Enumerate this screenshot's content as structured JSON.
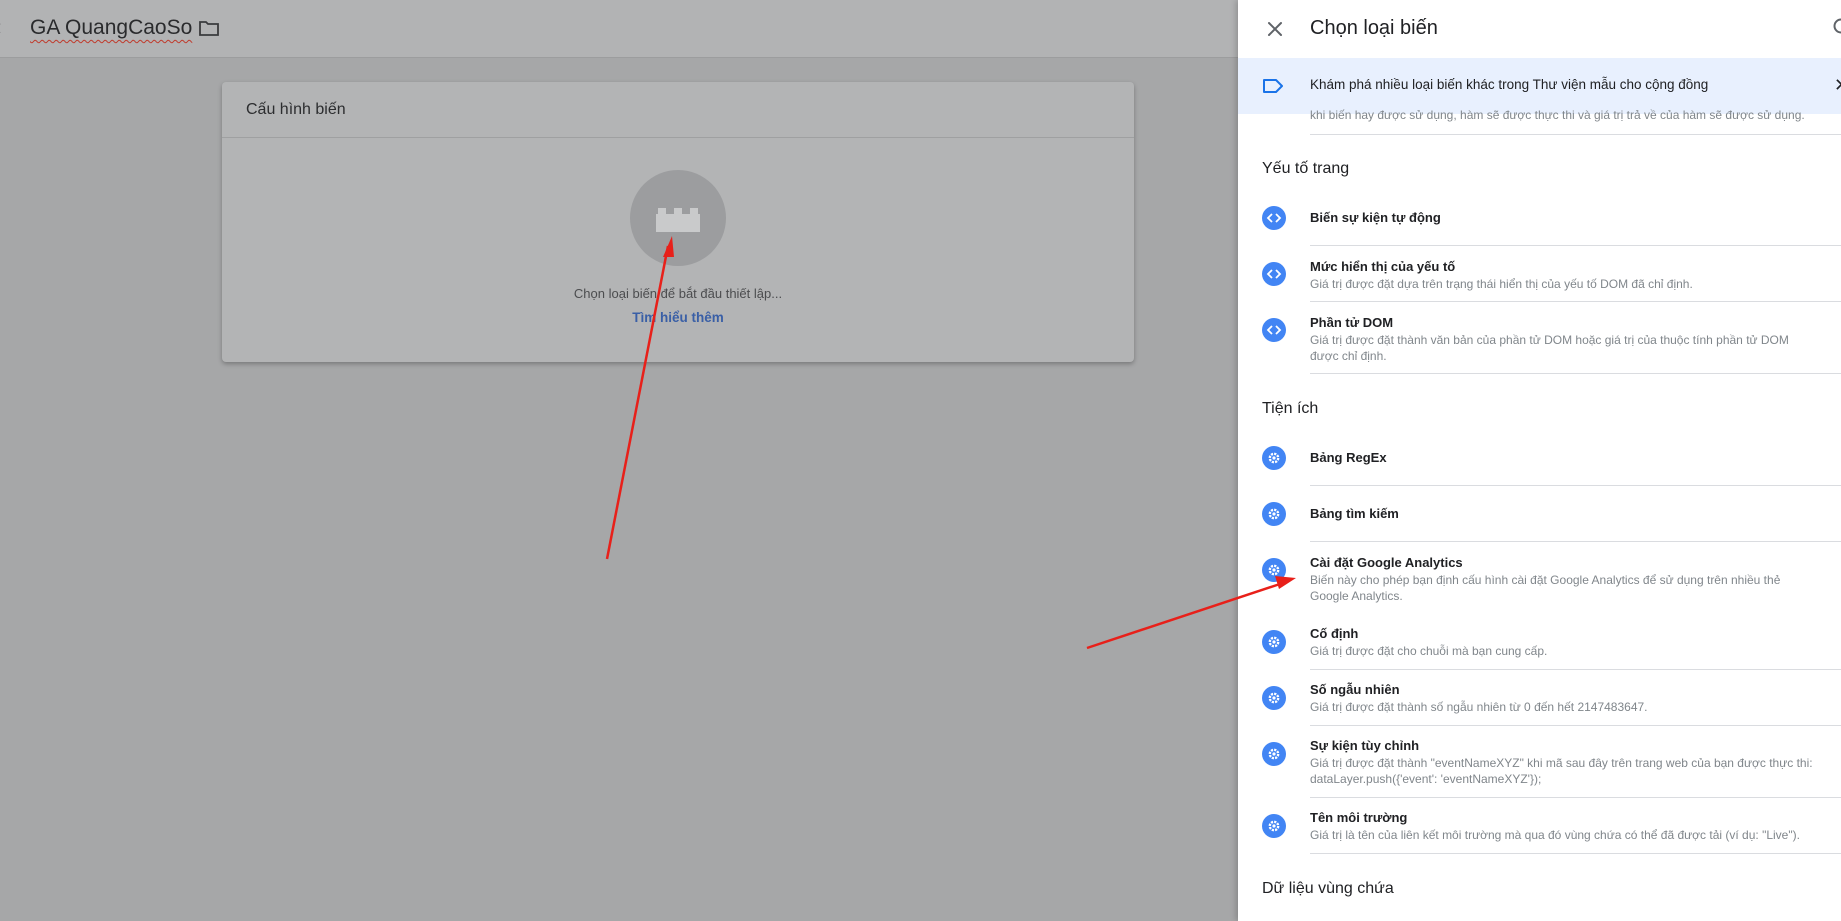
{
  "workspace": {
    "title": "GA QuangCaoSo"
  },
  "config_card": {
    "header": "Cấu hình biến",
    "placeholder_text": "Chọn loại biến để bắt đầu thiết lập...",
    "learn_more": "Tìm hiểu thêm"
  },
  "panel": {
    "title": "Chọn loại biến",
    "banner_text": "Khám phá nhiều loại biến khác trong Thư viện mẫu cho cộng đồng",
    "cut_off_desc": "khi biến hay được sử dụng, hàm sẽ được thực thi và giá trị trả về của hàm sẽ được sử dụng.",
    "sections": [
      {
        "title": "Yếu tố trang",
        "items": [
          {
            "name": "Biến sự kiện tự động",
            "desc": "",
            "icon": "code-icon"
          },
          {
            "name": "Mức hiển thị của yếu tố",
            "desc": "Giá trị được đặt dựa trên trạng thái hiển thị của yếu tố DOM đã chỉ định.",
            "icon": "code-icon"
          },
          {
            "name": "Phần tử DOM",
            "desc": "Giá trị được đặt thành văn bản của phần tử DOM hoặc giá trị của thuộc tính phần tử DOM\nđược chỉ định.",
            "icon": "code-icon"
          }
        ]
      },
      {
        "title": "Tiện ích",
        "items": [
          {
            "name": "Bảng RegEx",
            "desc": "",
            "icon": "gear-icon"
          },
          {
            "name": "Bảng tìm kiếm",
            "desc": "",
            "icon": "gear-icon"
          },
          {
            "name": "Cài đặt Google Analytics",
            "desc": "Biến này cho phép bạn định cấu hình cài đặt Google Analytics để sử dụng trên nhiều thẻ\nGoogle Analytics.",
            "icon": "gear-icon"
          },
          {
            "name": "Cố định",
            "desc": "Giá trị được đặt cho chuỗi mà bạn cung cấp.",
            "icon": "gear-icon"
          },
          {
            "name": "Số ngẫu nhiên",
            "desc": "Giá trị được đặt thành số ngẫu nhiên từ 0 đến hết 2147483647.",
            "icon": "gear-icon"
          },
          {
            "name": "Sự kiện tùy chỉnh",
            "desc": "Giá trị được đặt thành \"eventNameXYZ\" khi mã sau đây trên trang web của bạn được thực thi:\n  dataLayer.push({'event': 'eventNameXYZ'});",
            "icon": "gear-icon"
          },
          {
            "name": "Tên môi trường",
            "desc": "Giá trị là tên của liên kết môi trường mà qua đó vùng chứa có thể đã được tải (ví dụ: \"Live\").",
            "icon": "gear-icon"
          }
        ]
      },
      {
        "title": "Dữ liệu vùng chứa",
        "items": []
      }
    ]
  },
  "colors": {
    "overlay": "#a6a7a8",
    "panel_bg": "#ffffff",
    "accent_icon": "#4285f4",
    "banner_bg": "#e8f0fe",
    "annotation_arrow": "#e8201a"
  }
}
